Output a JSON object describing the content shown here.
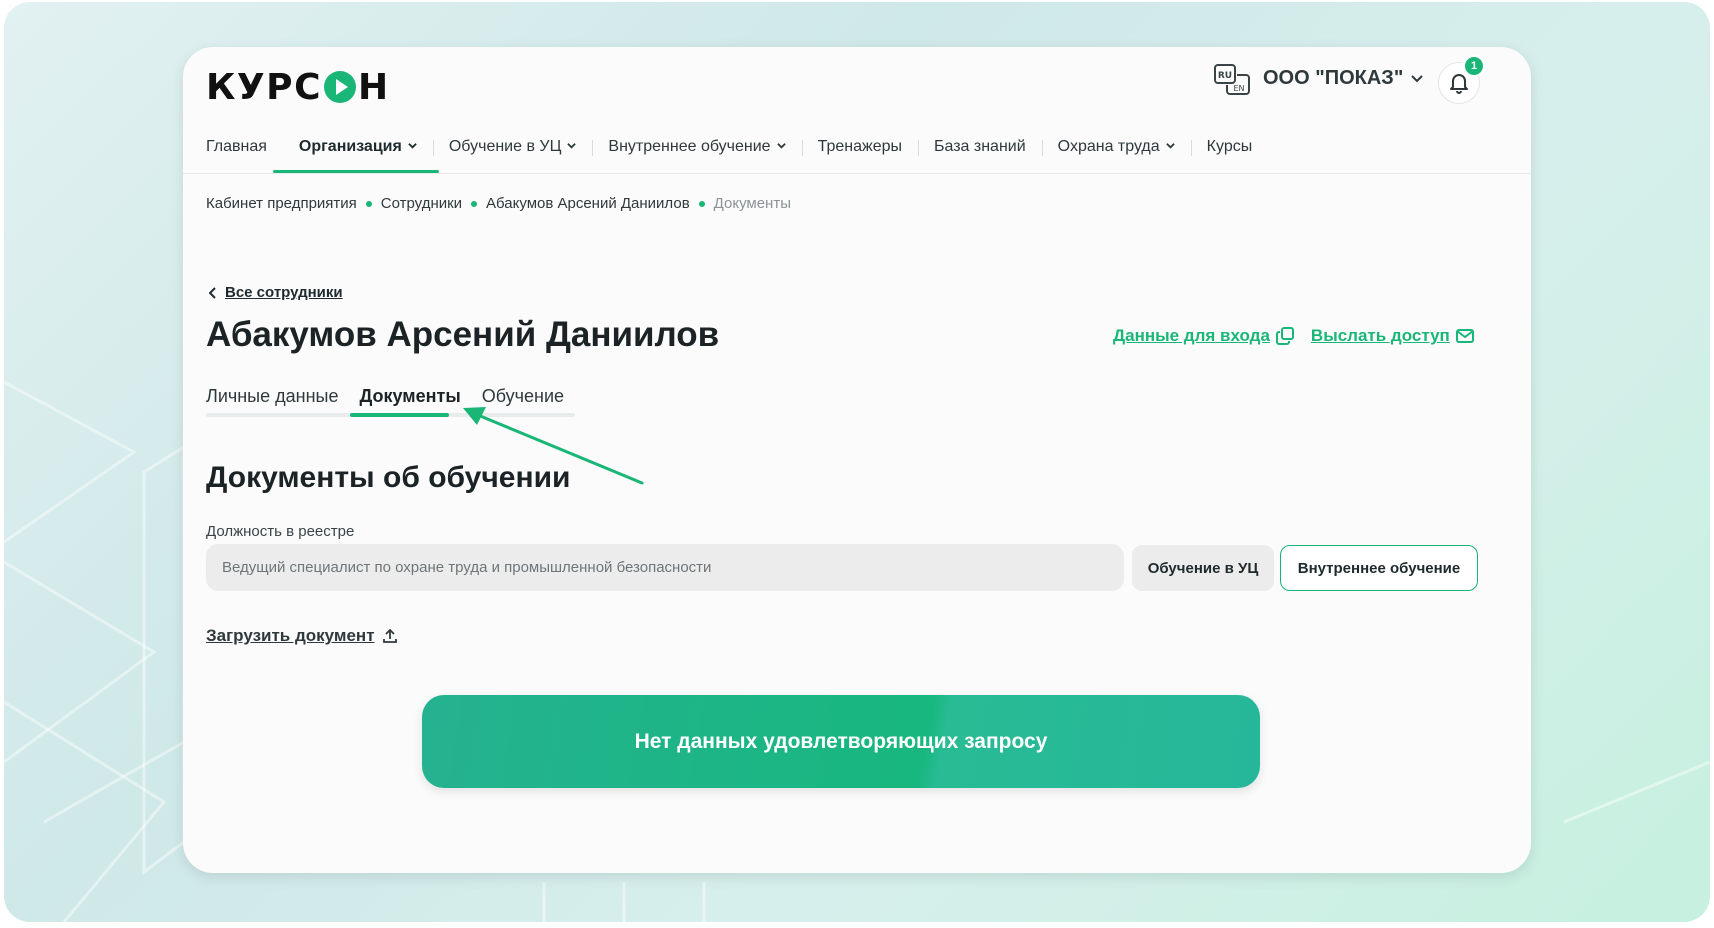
{
  "brand": {
    "logo_text_left": "КУРС",
    "logo_text_right": "Н"
  },
  "header": {
    "lang_icon": "ru-en-lang-icon",
    "org_name": "ООО \"ПОКАЗ\"",
    "notification_count": "1"
  },
  "nav": {
    "items": [
      {
        "label": "Главная"
      },
      {
        "label": "Организация"
      },
      {
        "label": "Обучение в УЦ"
      },
      {
        "label": "Внутреннее обучение"
      },
      {
        "label": "Тренажеры"
      },
      {
        "label": "База знаний"
      },
      {
        "label": "Охрана труда"
      },
      {
        "label": "Курсы"
      }
    ]
  },
  "breadcrumb": [
    "Кабинет предприятия",
    "Сотрудники",
    "Абакумов Арсений Даниилов",
    "Документы"
  ],
  "back_link": "Все сотрудники",
  "page_title": "Абакумов Арсений Даниилов",
  "top_links": {
    "login_data": "Данные для входа",
    "send_access": "Выслать доступ"
  },
  "tabs": [
    "Личные данные",
    "Документы",
    "Обучение"
  ],
  "section_title": "Документы об обучении",
  "position_field": {
    "label": "Должность в реестре",
    "value": "Ведущий специалист по охране труда и промышленной безопасности"
  },
  "buttons": {
    "uc_training": "Обучение в УЦ",
    "internal_training": "Внутреннее обучение"
  },
  "upload_label": "Загрузить документ",
  "empty_message": "Нет данных удовлетворяющих запросу",
  "colors": {
    "accent": "#1ab677",
    "text": "#1f2a2e"
  }
}
